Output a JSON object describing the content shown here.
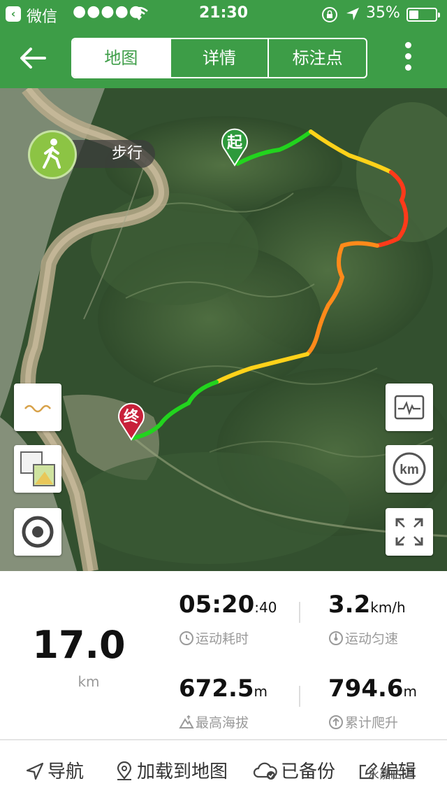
{
  "status_bar": {
    "back_app": "微信",
    "signal": "●●●●●",
    "time": "21:30",
    "battery_percent": "35%",
    "battery_level": 0.35
  },
  "nav": {
    "tabs": [
      {
        "label": "地图",
        "active": true
      },
      {
        "label": "详情",
        "active": false
      },
      {
        "label": "标注点",
        "active": false
      }
    ]
  },
  "map": {
    "mode_label": "步行",
    "start_label": "起",
    "end_label": "终",
    "km_label": "km",
    "colors": {
      "start_pin": "#2e9a3c",
      "end_pin": "#c8213a",
      "route_slow": "#ff3a1a",
      "route_mid": "#ffd21a",
      "route_fast": "#22d41e"
    }
  },
  "stats": {
    "distance": "17.0",
    "distance_unit": "km",
    "duration_main": "05:20",
    "duration_sec": ":40",
    "duration_label": "运动耗时",
    "speed_value": "3.2",
    "speed_unit": "km/h",
    "speed_label": "运动匀速",
    "altitude_value": "672.5",
    "altitude_unit": "m",
    "altitude_label": "最高海拔",
    "climb_value": "794.6",
    "climb_unit": "m",
    "climb_label": "累计爬升"
  },
  "toolbar": {
    "navigate": "导航",
    "load_map": "加载到地图",
    "backed_up": "已备份",
    "edit": "编辑"
  },
  "watermark": "永嘉古道"
}
